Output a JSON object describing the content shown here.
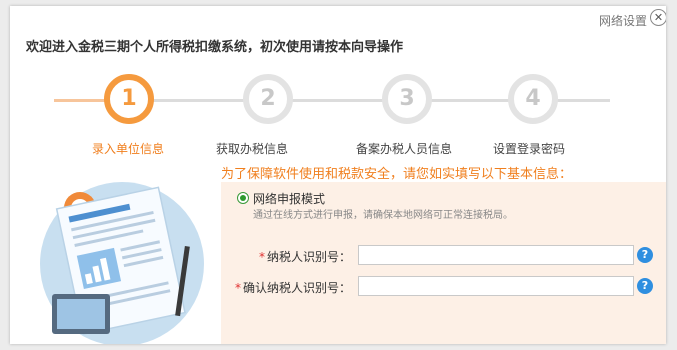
{
  "header": {
    "network_settings": "网络设置",
    "close_symbol": "✕",
    "welcome": "欢迎进入金税三期个人所得税扣缴系统，初次使用请按本向导操作"
  },
  "steps": [
    {
      "number": "1",
      "label": "录入单位信息",
      "active": true
    },
    {
      "number": "2",
      "label": "获取办税信息",
      "active": false
    },
    {
      "number": "3",
      "label": "备案办税人员信息",
      "active": false
    },
    {
      "number": "4",
      "label": "设置登录密码",
      "active": false
    }
  ],
  "form": {
    "notice": "为了保障软件使用和税款安全，请您如实填写以下基本信息：",
    "mode_label": "网络申报模式",
    "mode_desc": "通过在线方式进行申报，请确保本地网络可正常连接税局。",
    "required_mark": "*",
    "taxpayer_id_label": "纳税人识别号：",
    "taxpayer_id_value": "",
    "confirm_id_label": "确认纳税人识别号：",
    "confirm_id_value": "",
    "help_symbol": "?"
  },
  "colors": {
    "accent": "#f59a3e",
    "panel_bg": "#fdf0e6",
    "help_blue": "#2f8fe0",
    "inactive_step": "#e3e3e3"
  },
  "icons": [
    "close-icon",
    "help-icon",
    "radio-selected",
    "document-illustration"
  ]
}
